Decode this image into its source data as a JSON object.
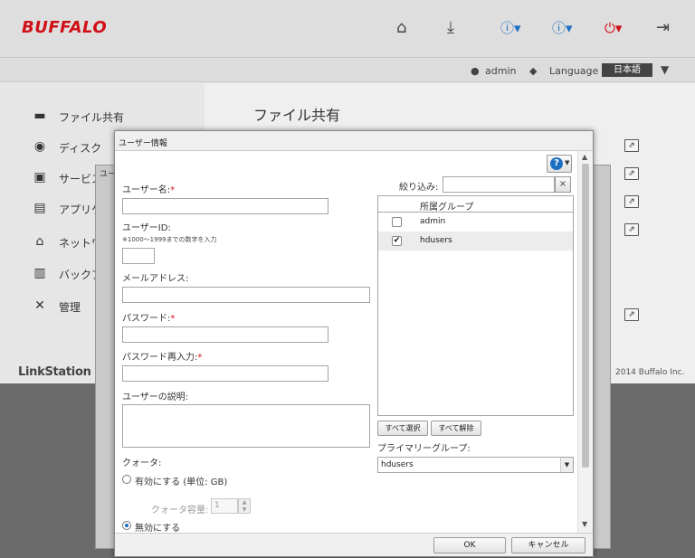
{
  "header": {
    "brand": "BUFFALO",
    "user": "admin",
    "language_label": "Language",
    "language_value": "日本語",
    "icons": [
      "home-icon",
      "download-icon",
      "help-icon",
      "info-icon",
      "power-icon",
      "logout-icon"
    ]
  },
  "sidebar": {
    "items": [
      {
        "label": "ファイル共有",
        "icon": "folder-icon"
      },
      {
        "label": "ディスク",
        "icon": "disk-icon"
      },
      {
        "label": "サービス",
        "icon": "service-icon"
      },
      {
        "label": "アプリケ",
        "icon": "app-icon"
      },
      {
        "label": "ネットワ",
        "icon": "network-icon"
      },
      {
        "label": "バックア",
        "icon": "backup-icon"
      },
      {
        "label": "管理",
        "icon": "tools-icon"
      }
    ]
  },
  "main": {
    "title": "ファイル共有",
    "brand_footer": "LinkStation",
    "copyright": "2014 Buffalo Inc.",
    "under_dialog_title": "ユー"
  },
  "dialog": {
    "title": "ユーザー情報",
    "username_label": "ユーザー名:",
    "userid_label": "ユーザーID:",
    "userid_note": "※1000～1999までの数字を入力",
    "email_label": "メールアドレス:",
    "password_label": "パスワード:",
    "password_confirm_label": "パスワード再入力:",
    "description_label": "ユーザーの説明:",
    "required_mark": "*",
    "quota_label": "クォータ:",
    "quota_enable_label": "有効にする (単位: GB)",
    "quota_capacity_label": "クォータ容量:",
    "quota_capacity_value": "1",
    "quota_disable_label": "無効にする",
    "filter_label": "絞り込み:",
    "filter_clear": "×",
    "groups_header": "所属グループ",
    "groups": [
      {
        "name": "admin",
        "checked": false
      },
      {
        "name": "hdusers",
        "checked": true
      }
    ],
    "select_all_label": "すべて選択",
    "deselect_all_label": "すべて解除",
    "primary_group_label": "プライマリーグループ:",
    "primary_group_value": "hdusers",
    "ok_label": "OK",
    "cancel_label": "キャンセル"
  }
}
